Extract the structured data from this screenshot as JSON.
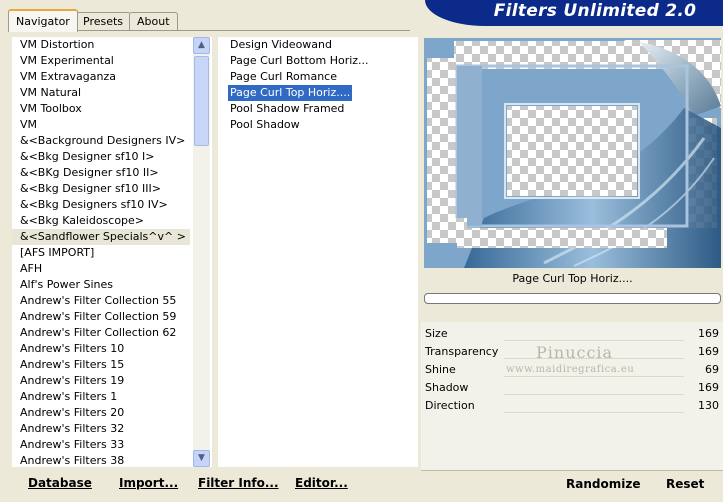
{
  "tabs": [
    {
      "label": "Navigator",
      "active": true
    },
    {
      "label": "Presets",
      "active": false
    },
    {
      "label": "About",
      "active": false
    }
  ],
  "app_title": "Filters Unlimited 2.0",
  "categories": [
    "VM Distortion",
    "VM Experimental",
    "VM Extravaganza",
    "VM Natural",
    "VM Toolbox",
    "VM",
    "&<Background Designers IV>",
    "&<Bkg Designer sf10 I>",
    "&<BKg Designer sf10 II>",
    "&<Bkg Designer sf10 III>",
    "&<Bkg Designers sf10 IV>",
    "&<Bkg Kaleidoscope>",
    "&<Sandflower Specials^v^ >",
    "[AFS IMPORT]",
    "AFH",
    "Alf's Power Sines",
    "Andrew's Filter Collection 55",
    "Andrew's Filter Collection 59",
    "Andrew's Filter Collection 62",
    "Andrew's Filters 10",
    "Andrew's Filters 15",
    "Andrew's Filters 19",
    "Andrew's Filters 1",
    "Andrew's Filters 20",
    "Andrew's Filters 32",
    "Andrew's Filters 33",
    "Andrew's Filters 38"
  ],
  "selected_category_index": 12,
  "filters": [
    "Design Videowand",
    "Page Curl Bottom Horiz...",
    "Page Curl Romance",
    "Page Curl Top Horiz....",
    "Pool Shadow Framed",
    "Pool Shadow"
  ],
  "selected_filter_index": 3,
  "buttons": {
    "database": "Database",
    "import": "Import...",
    "filter_info": "Filter Info...",
    "editor": "Editor...",
    "randomize": "Randomize",
    "reset": "Reset"
  },
  "preview_filter_name": "Page Curl Top Horiz....",
  "parameters": [
    {
      "name": "Size",
      "value": "169"
    },
    {
      "name": "Transparency",
      "value": "169"
    },
    {
      "name": "Shine",
      "value": "69"
    },
    {
      "name": "Shadow",
      "value": "169"
    },
    {
      "name": "Direction",
      "value": "130"
    }
  ],
  "watermark": {
    "name": "Pinuccia",
    "site": "www.maidiregrafica.eu"
  },
  "colors": {
    "banner_bg": "#0b2a8a",
    "selection": "#316ac5",
    "dialog_bg": "#ece9d8"
  }
}
